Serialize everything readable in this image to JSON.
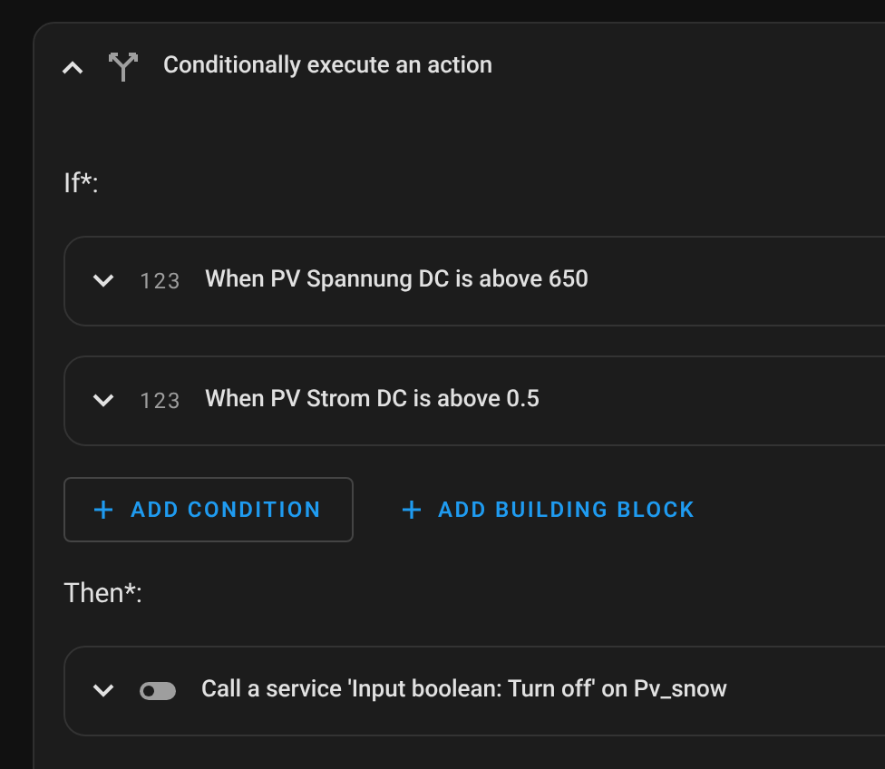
{
  "block": {
    "title": "Conditionally execute an action",
    "expanded": true
  },
  "if_label": "If*:",
  "conditions": [
    {
      "kind": "numeric",
      "glyph": "123",
      "text": "When PV Spannung DC is above 650",
      "expanded": false
    },
    {
      "kind": "numeric",
      "glyph": "123",
      "text": "When PV Strom DC is above 0.5",
      "expanded": false
    }
  ],
  "buttons": [
    {
      "label": "ADD CONDITION",
      "outlined": true
    },
    {
      "label": "ADD BUILDING BLOCK",
      "outlined": false
    }
  ],
  "then_label": "Then*:",
  "actions": [
    {
      "kind": "toggle",
      "text": "Call a service 'Input boolean: Turn off' on Pv_snow",
      "expanded": false
    }
  ]
}
